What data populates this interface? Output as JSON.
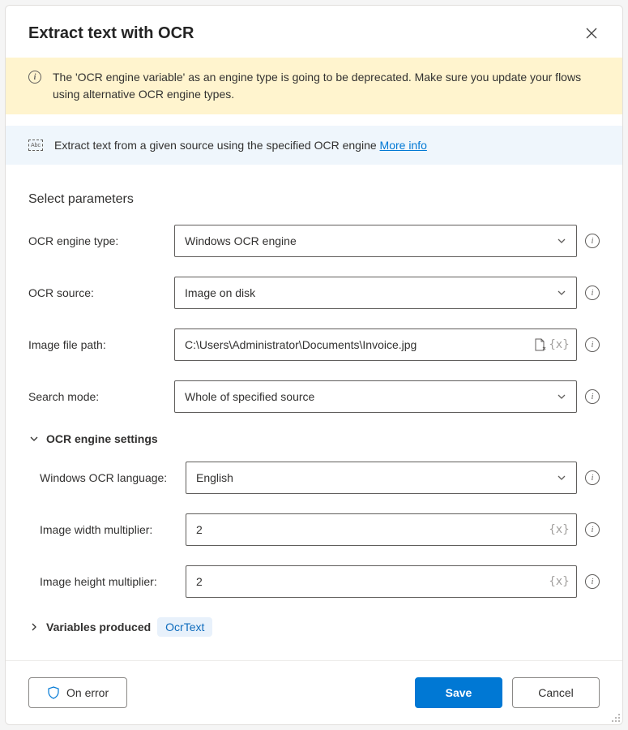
{
  "dialog": {
    "title": "Extract text with OCR"
  },
  "warning": {
    "text": "The 'OCR engine variable' as an engine type is going to be deprecated.  Make sure you update your flows using alternative OCR engine types."
  },
  "description": {
    "text": "Extract text from a given source using the specified OCR engine ",
    "link_label": "More info"
  },
  "section": {
    "title": "Select parameters"
  },
  "fields": {
    "engine_type": {
      "label": "OCR engine type:",
      "value": "Windows OCR engine"
    },
    "source": {
      "label": "OCR source:",
      "value": "Image on disk"
    },
    "file_path": {
      "label": "Image file path:",
      "value": "C:\\Users\\Administrator\\Documents\\Invoice.jpg"
    },
    "search_mode": {
      "label": "Search mode:",
      "value": "Whole of specified source"
    }
  },
  "group": {
    "engine_settings": {
      "label": "OCR engine settings"
    },
    "language": {
      "label": "Windows OCR language:",
      "value": "English"
    },
    "width_mult": {
      "label": "Image width multiplier:",
      "value": "2"
    },
    "height_mult": {
      "label": "Image height multiplier:",
      "value": "2"
    }
  },
  "variables": {
    "label": "Variables produced",
    "tag": "OcrText"
  },
  "footer": {
    "on_error": "On error",
    "save": "Save",
    "cancel": "Cancel"
  },
  "glyphs": {
    "vx": "{x}",
    "info": "i",
    "abc": "Abc"
  }
}
